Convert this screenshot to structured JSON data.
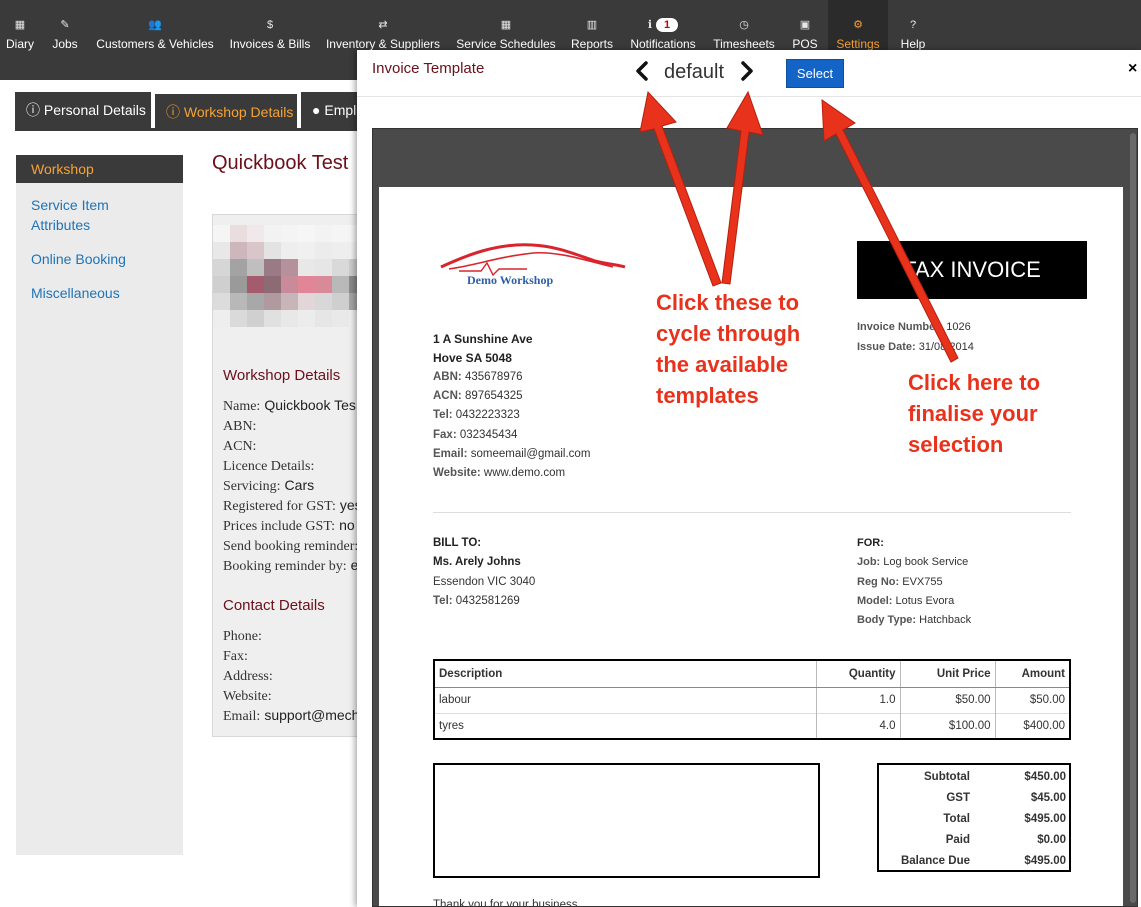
{
  "nav": {
    "items": [
      {
        "label": "Diary",
        "icon": "calendar-icon",
        "glyph": "▦"
      },
      {
        "label": "Jobs",
        "icon": "wrench-icon",
        "glyph": "✎"
      },
      {
        "label": "Customers & Vehicles",
        "icon": "users-icon",
        "glyph": "👥"
      },
      {
        "label": "Invoices & Bills",
        "icon": "dollar-icon",
        "glyph": "$"
      },
      {
        "label": "Inventory & Suppliers",
        "icon": "exchange-icon",
        "glyph": "⇄"
      },
      {
        "label": "Service Schedules",
        "icon": "calendar-icon",
        "glyph": "▦"
      },
      {
        "label": "Reports",
        "icon": "bar-chart-icon",
        "glyph": "▥"
      },
      {
        "label": "Notifications",
        "icon": "info-icon",
        "glyph": "ℹ",
        "badge": "1"
      },
      {
        "label": "Timesheets",
        "icon": "clock-icon",
        "glyph": "◷"
      },
      {
        "label": "POS",
        "icon": "cash-icon",
        "glyph": "▣"
      },
      {
        "label": "Settings",
        "icon": "gears-icon",
        "glyph": "⚙"
      },
      {
        "label": "Help",
        "icon": "question-icon",
        "glyph": "?"
      }
    ]
  },
  "tabs": [
    {
      "label": "Personal Details",
      "icon": "info-icon"
    },
    {
      "label": "Workshop Details",
      "icon": "info-icon"
    },
    {
      "label": "Empl",
      "icon": "user-icon"
    }
  ],
  "sidebar": {
    "items": [
      "Workshop",
      "Service Item Attributes",
      "Online Booking",
      "Miscellaneous"
    ]
  },
  "page": {
    "title": "Quickbook Test",
    "workshop_heading": "Workshop Details",
    "workshop_rows": [
      {
        "label": "Name:",
        "value": "Quickbook Tes"
      },
      {
        "label": "ABN:",
        "value": ""
      },
      {
        "label": "ACN:",
        "value": ""
      },
      {
        "label": "Licence Details:",
        "value": ""
      },
      {
        "label": "Servicing:",
        "value": "Cars"
      },
      {
        "label": "Registered for GST:",
        "value": "yes"
      },
      {
        "label": "Prices include GST:",
        "value": "no"
      },
      {
        "label": "Send booking reminder:",
        "value": ""
      },
      {
        "label": "Booking reminder by:",
        "value": "e"
      }
    ],
    "contact_heading": "Contact Details",
    "contact_rows": [
      {
        "label": "Phone:",
        "value": ""
      },
      {
        "label": "Fax:",
        "value": ""
      },
      {
        "label": "Address:",
        "value": ""
      },
      {
        "label": "Website:",
        "value": ""
      },
      {
        "label": "Email:",
        "value": "support@mech"
      }
    ]
  },
  "modal": {
    "title": "Invoice Template",
    "template_name": "default",
    "select_label": "Select",
    "close_label": "×"
  },
  "invoice": {
    "logo_text": "Demo Workshop",
    "doc_title": "TAX INVOICE",
    "invoice_number_label": "Invoice Number:",
    "invoice_number": "1026",
    "issue_date_label": "Issue Date:",
    "issue_date": "31/08/2014",
    "address1": "1 A Sunshine Ave",
    "address2": "Hove SA 5048",
    "abn_label": "ABN:",
    "abn": "435678976",
    "acn_label": "ACN:",
    "acn": "897654325",
    "tel_label": "Tel:",
    "tel": "0432223323",
    "fax_label": "Fax:",
    "fax": "032345434",
    "email_label": "Email:",
    "email": "someemail@gmail.com",
    "website_label": "Website:",
    "website": "www.demo.com",
    "bill_to_label": "BILL TO:",
    "bill_name": "Ms. Arely Johns",
    "bill_city": "Essendon VIC 3040",
    "bill_tel_label": "Tel:",
    "bill_tel": "0432581269",
    "for_label": "FOR:",
    "job_label": "Job:",
    "job": "Log book Service",
    "reg_label": "Reg No:",
    "reg": "EVX755",
    "model_label": "Model:",
    "model": "Lotus Evora",
    "body_label": "Body Type:",
    "body": "Hatchback",
    "columns": [
      "Description",
      "Quantity",
      "Unit Price",
      "Amount"
    ],
    "rows": [
      [
        "labour",
        "1.0",
        "$50.00",
        "$50.00"
      ],
      [
        "tyres",
        "4.0",
        "$100.00",
        "$400.00"
      ]
    ],
    "totals": [
      {
        "label": "Subtotal",
        "value": "$450.00"
      },
      {
        "label": "GST",
        "value": "$45.00"
      },
      {
        "label": "Total",
        "value": "$495.00"
      },
      {
        "label": "Paid",
        "value": "$0.00"
      },
      {
        "label": "Balance Due",
        "value": "$495.00"
      }
    ],
    "thanks": "Thank you for your business"
  },
  "annotations": {
    "cycle": "Click these to\ncycle through\nthe available\ntemplates",
    "finalise": "Click here to\nfinalise your\nselection"
  },
  "colors": {
    "accent_orange": "#f7a234",
    "nav_bg": "#3a3a3a",
    "heading_maroon": "#6b0f1a",
    "link_blue": "#1f73b7",
    "select_blue": "#1464c8",
    "annotation_red": "#e8321c"
  }
}
